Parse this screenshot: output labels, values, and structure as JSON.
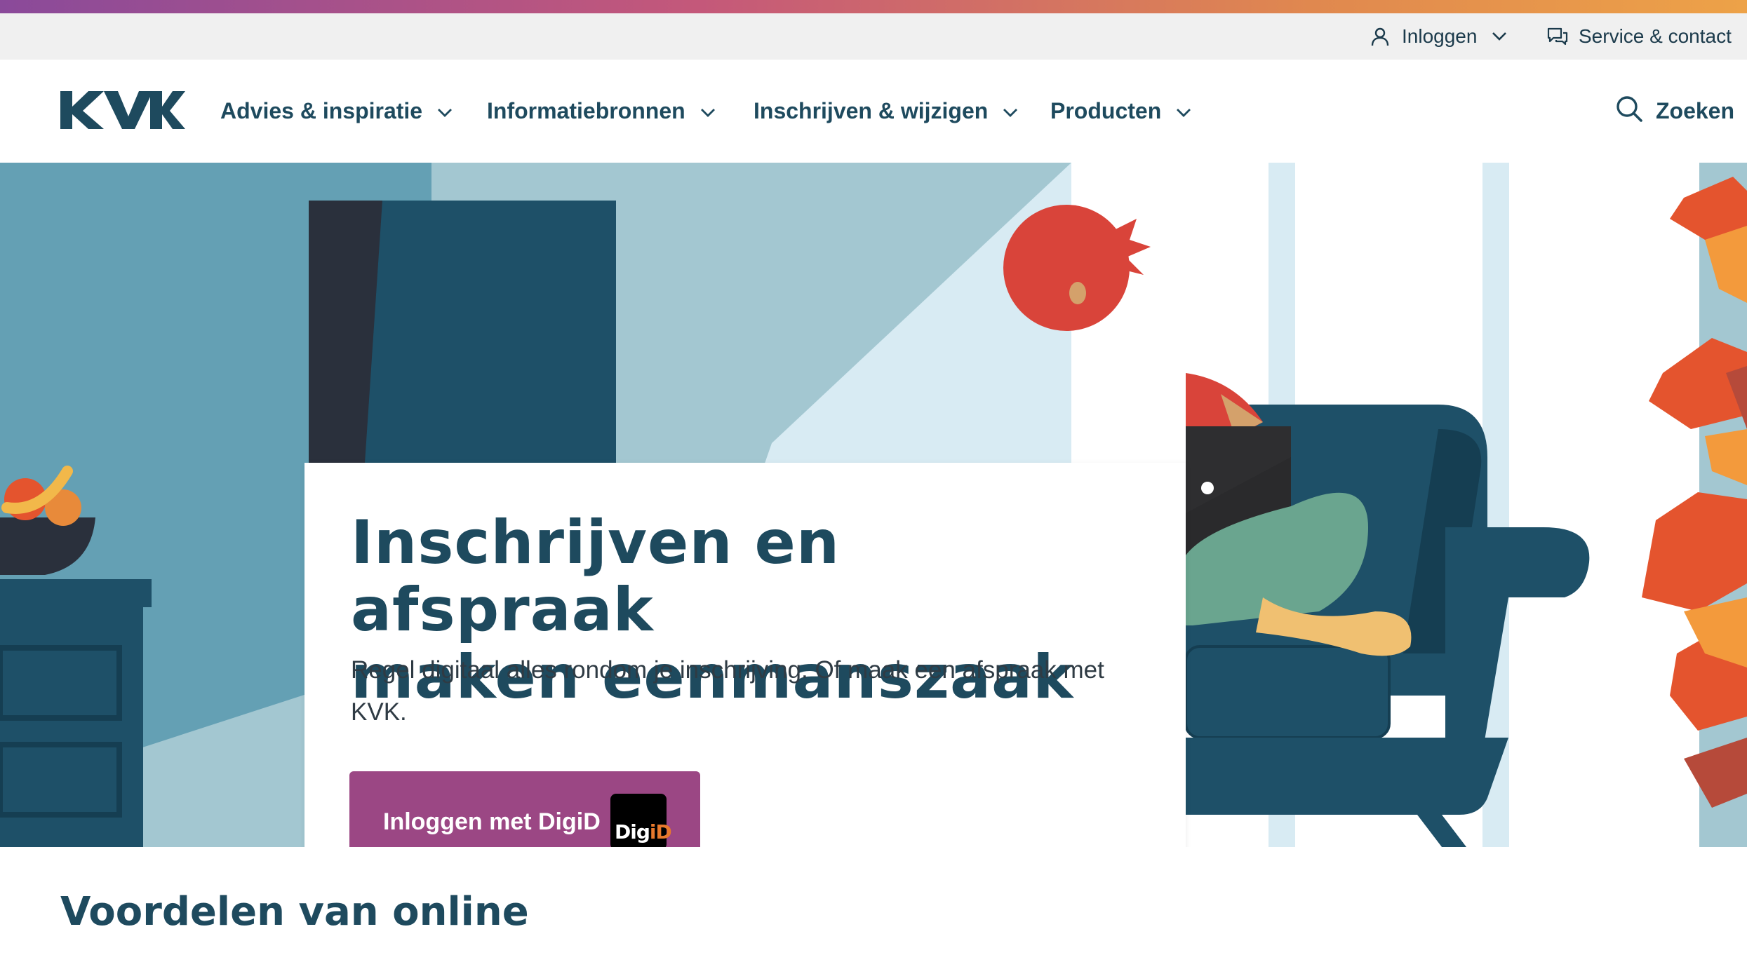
{
  "top_bar": {
    "login_label": "Inloggen",
    "service_label": "Service & contact"
  },
  "header": {
    "logo_text": "KVK",
    "nav": [
      {
        "label": "Advies & inspiratie"
      },
      {
        "label": "Informatiebronnen"
      },
      {
        "label": "Inschrijven & wijzigen"
      },
      {
        "label": "Producten"
      }
    ],
    "search_label": "Zoeken"
  },
  "hero": {
    "title_line1": "Inschrijven en afspraak",
    "title_line2": "maken eenmanszaak",
    "subtitle": "Regel digitaal alles rondom je inschrijving. Of maak een afspraak met KVK.",
    "button_label": "Inloggen met DigiD",
    "digid_logo_text_white": "Dig",
    "digid_logo_text_orange": "iD"
  },
  "section": {
    "title": "Voordelen van online"
  },
  "colors": {
    "brand_dark_blue": "#1e4a5e",
    "button_purple": "#9b4784",
    "utility_bar_bg": "#f0f0f0"
  },
  "icons": {
    "login": "user-icon",
    "service": "chat-bubbles-icon",
    "search": "search-icon",
    "dropdown": "chevron-down-icon"
  }
}
